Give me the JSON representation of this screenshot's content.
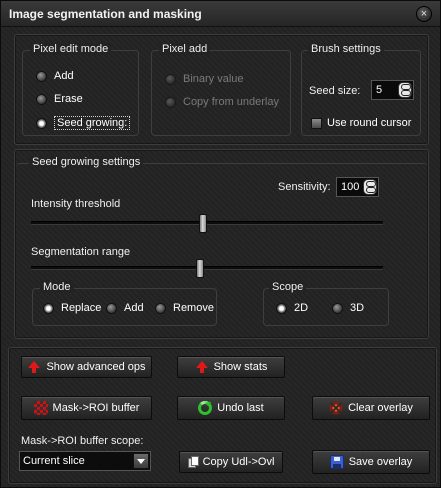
{
  "window": {
    "title": "Image segmentation and masking",
    "close_glyph": "×"
  },
  "pixel_edit_mode": {
    "legend": "Pixel edit mode",
    "options": [
      {
        "label": "Add",
        "checked": false
      },
      {
        "label": "Erase",
        "checked": false
      },
      {
        "label": "Seed growing:",
        "checked": true
      }
    ]
  },
  "pixel_add": {
    "legend": "Pixel add",
    "options": [
      {
        "label": "Binary value",
        "checked": false
      },
      {
        "label": "Copy from underlay",
        "checked": false
      }
    ]
  },
  "brush_settings": {
    "legend": "Brush settings",
    "seed_size_label": "Seed size:",
    "seed_size_value": "5",
    "round_cursor_label": "Use round cursor",
    "round_cursor_checked": false
  },
  "seed_growing": {
    "legend": "Seed growing settings",
    "sensitivity_label": "Sensitivity:",
    "sensitivity_value": "100",
    "intensity_label": "Intensity threshold",
    "intensity_level": 0.49,
    "range_label": "Segmentation range",
    "range_level": 0.48,
    "mode": {
      "legend": "Mode",
      "options": [
        {
          "label": "Replace",
          "checked": true
        },
        {
          "label": "Add",
          "checked": false
        },
        {
          "label": "Remove",
          "checked": false
        }
      ]
    },
    "scope": {
      "legend": "Scope",
      "options": [
        {
          "label": "2D",
          "checked": true
        },
        {
          "label": "3D",
          "checked": false
        }
      ]
    }
  },
  "buttons": {
    "show_advanced": "Show advanced ops",
    "show_stats": "Show stats",
    "mask_to_roi": "Mask->ROI buffer",
    "undo_last": "Undo last",
    "clear_overlay": "Clear overlay",
    "copy_udl": "Copy Udl->Ovl",
    "save_overlay": "Save overlay"
  },
  "roi_scope": {
    "label": "Mask->ROI buffer scope:",
    "selected": "Current slice"
  },
  "icons": {
    "show_advanced": "red-up-arrow-icon",
    "show_stats": "red-up-arrow-icon",
    "mask_to_roi": "mask-icon",
    "undo_last": "undo-icon",
    "clear_overlay": "clear-icon",
    "copy_udl": "copy-icon",
    "save_overlay": "save-icon"
  }
}
